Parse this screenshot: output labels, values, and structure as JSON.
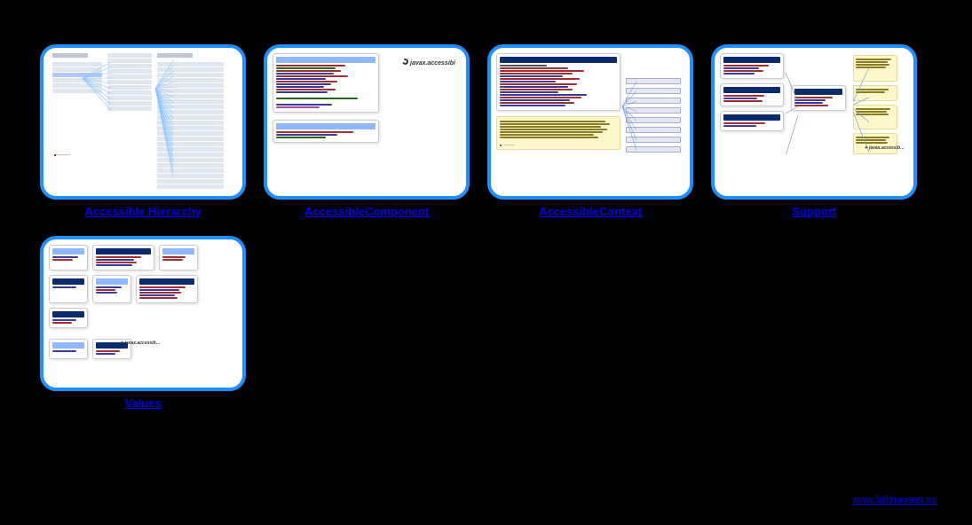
{
  "diagrams": [
    {
      "id": "accessible-hierarchy",
      "caption": "Accessible Hierarchy"
    },
    {
      "id": "accessible-component",
      "caption": "AccessibleComponent"
    },
    {
      "id": "accessible-context",
      "caption": "AccessibleContext"
    },
    {
      "id": "support",
      "caption": "Support"
    },
    {
      "id": "values",
      "caption": "Values"
    }
  ],
  "package_label": "javax.accessibi",
  "footer_link": "www.falkhausen.de",
  "colors": {
    "thumb_border": "#1f8fff",
    "link": "#0000ee",
    "class_header": "#0a2a6b",
    "interface_header": "#8fb8ff",
    "note_bg": "#fff8cc"
  }
}
